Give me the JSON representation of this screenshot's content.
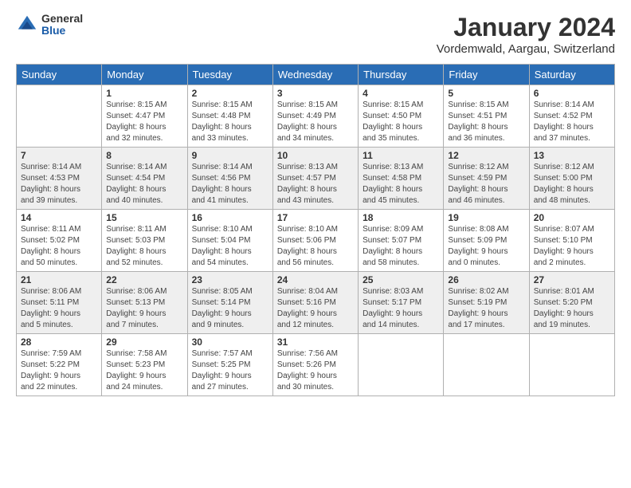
{
  "header": {
    "logo": {
      "general": "General",
      "blue": "Blue"
    },
    "title": "January 2024",
    "location": "Vordemwald, Aargau, Switzerland"
  },
  "days": [
    "Sunday",
    "Monday",
    "Tuesday",
    "Wednesday",
    "Thursday",
    "Friday",
    "Saturday"
  ],
  "weeks": [
    [
      {
        "num": "",
        "info": ""
      },
      {
        "num": "1",
        "info": "Sunrise: 8:15 AM\nSunset: 4:47 PM\nDaylight: 8 hours\nand 32 minutes."
      },
      {
        "num": "2",
        "info": "Sunrise: 8:15 AM\nSunset: 4:48 PM\nDaylight: 8 hours\nand 33 minutes."
      },
      {
        "num": "3",
        "info": "Sunrise: 8:15 AM\nSunset: 4:49 PM\nDaylight: 8 hours\nand 34 minutes."
      },
      {
        "num": "4",
        "info": "Sunrise: 8:15 AM\nSunset: 4:50 PM\nDaylight: 8 hours\nand 35 minutes."
      },
      {
        "num": "5",
        "info": "Sunrise: 8:15 AM\nSunset: 4:51 PM\nDaylight: 8 hours\nand 36 minutes."
      },
      {
        "num": "6",
        "info": "Sunrise: 8:14 AM\nSunset: 4:52 PM\nDaylight: 8 hours\nand 37 minutes."
      }
    ],
    [
      {
        "num": "7",
        "info": "Sunrise: 8:14 AM\nSunset: 4:53 PM\nDaylight: 8 hours\nand 39 minutes."
      },
      {
        "num": "8",
        "info": "Sunrise: 8:14 AM\nSunset: 4:54 PM\nDaylight: 8 hours\nand 40 minutes."
      },
      {
        "num": "9",
        "info": "Sunrise: 8:14 AM\nSunset: 4:56 PM\nDaylight: 8 hours\nand 41 minutes."
      },
      {
        "num": "10",
        "info": "Sunrise: 8:13 AM\nSunset: 4:57 PM\nDaylight: 8 hours\nand 43 minutes."
      },
      {
        "num": "11",
        "info": "Sunrise: 8:13 AM\nSunset: 4:58 PM\nDaylight: 8 hours\nand 45 minutes."
      },
      {
        "num": "12",
        "info": "Sunrise: 8:12 AM\nSunset: 4:59 PM\nDaylight: 8 hours\nand 46 minutes."
      },
      {
        "num": "13",
        "info": "Sunrise: 8:12 AM\nSunset: 5:00 PM\nDaylight: 8 hours\nand 48 minutes."
      }
    ],
    [
      {
        "num": "14",
        "info": "Sunrise: 8:11 AM\nSunset: 5:02 PM\nDaylight: 8 hours\nand 50 minutes."
      },
      {
        "num": "15",
        "info": "Sunrise: 8:11 AM\nSunset: 5:03 PM\nDaylight: 8 hours\nand 52 minutes."
      },
      {
        "num": "16",
        "info": "Sunrise: 8:10 AM\nSunset: 5:04 PM\nDaylight: 8 hours\nand 54 minutes."
      },
      {
        "num": "17",
        "info": "Sunrise: 8:10 AM\nSunset: 5:06 PM\nDaylight: 8 hours\nand 56 minutes."
      },
      {
        "num": "18",
        "info": "Sunrise: 8:09 AM\nSunset: 5:07 PM\nDaylight: 8 hours\nand 58 minutes."
      },
      {
        "num": "19",
        "info": "Sunrise: 8:08 AM\nSunset: 5:09 PM\nDaylight: 9 hours\nand 0 minutes."
      },
      {
        "num": "20",
        "info": "Sunrise: 8:07 AM\nSunset: 5:10 PM\nDaylight: 9 hours\nand 2 minutes."
      }
    ],
    [
      {
        "num": "21",
        "info": "Sunrise: 8:06 AM\nSunset: 5:11 PM\nDaylight: 9 hours\nand 5 minutes."
      },
      {
        "num": "22",
        "info": "Sunrise: 8:06 AM\nSunset: 5:13 PM\nDaylight: 9 hours\nand 7 minutes."
      },
      {
        "num": "23",
        "info": "Sunrise: 8:05 AM\nSunset: 5:14 PM\nDaylight: 9 hours\nand 9 minutes."
      },
      {
        "num": "24",
        "info": "Sunrise: 8:04 AM\nSunset: 5:16 PM\nDaylight: 9 hours\nand 12 minutes."
      },
      {
        "num": "25",
        "info": "Sunrise: 8:03 AM\nSunset: 5:17 PM\nDaylight: 9 hours\nand 14 minutes."
      },
      {
        "num": "26",
        "info": "Sunrise: 8:02 AM\nSunset: 5:19 PM\nDaylight: 9 hours\nand 17 minutes."
      },
      {
        "num": "27",
        "info": "Sunrise: 8:01 AM\nSunset: 5:20 PM\nDaylight: 9 hours\nand 19 minutes."
      }
    ],
    [
      {
        "num": "28",
        "info": "Sunrise: 7:59 AM\nSunset: 5:22 PM\nDaylight: 9 hours\nand 22 minutes."
      },
      {
        "num": "29",
        "info": "Sunrise: 7:58 AM\nSunset: 5:23 PM\nDaylight: 9 hours\nand 24 minutes."
      },
      {
        "num": "30",
        "info": "Sunrise: 7:57 AM\nSunset: 5:25 PM\nDaylight: 9 hours\nand 27 minutes."
      },
      {
        "num": "31",
        "info": "Sunrise: 7:56 AM\nSunset: 5:26 PM\nDaylight: 9 hours\nand 30 minutes."
      },
      {
        "num": "",
        "info": ""
      },
      {
        "num": "",
        "info": ""
      },
      {
        "num": "",
        "info": ""
      }
    ]
  ]
}
